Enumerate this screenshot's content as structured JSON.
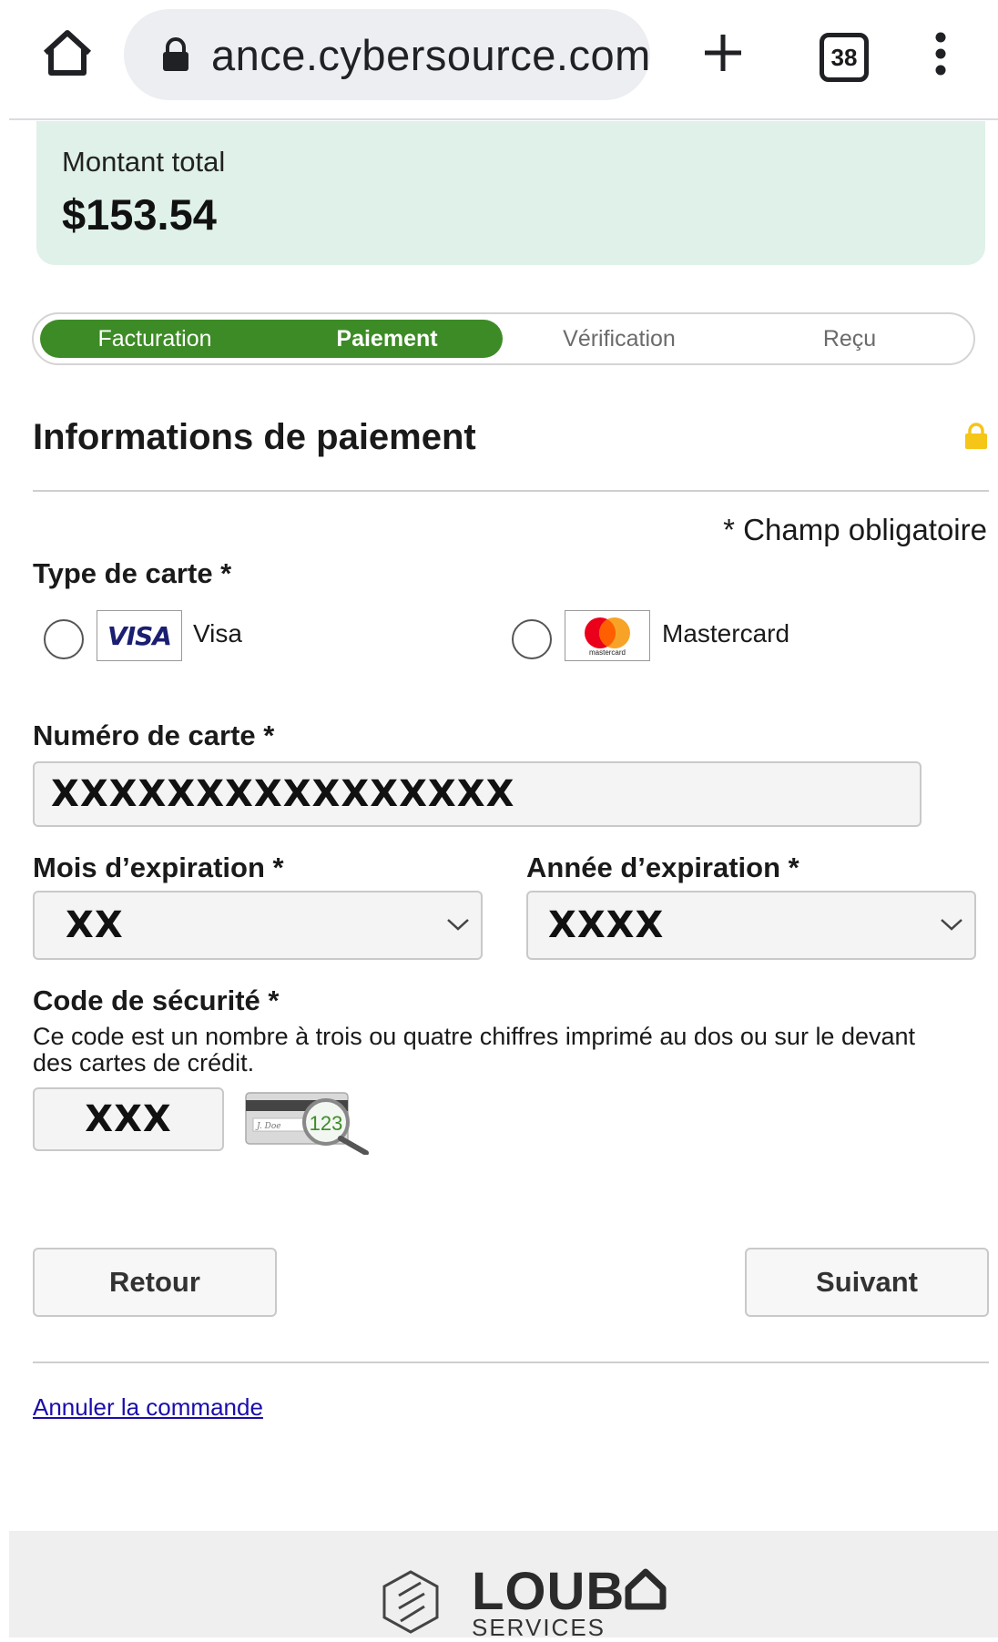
{
  "browser": {
    "url": "ance.cybersource.com",
    "tab_count": "38"
  },
  "summary": {
    "total_label": "Montant total",
    "total_amount": "$153.54"
  },
  "steps": [
    {
      "label": "Facturation",
      "state": "done"
    },
    {
      "label": "Paiement",
      "state": "current"
    },
    {
      "label": "Vérification",
      "state": "pending"
    },
    {
      "label": "Reçu",
      "state": "pending"
    }
  ],
  "form": {
    "title": "Informations de paiement",
    "required_note": "* Champ obligatoire",
    "card_type_label": "Type de carte *",
    "card_types": [
      {
        "name": "Visa",
        "logo_text": "VISA"
      },
      {
        "name": "Mastercard",
        "logo_text": "mastercard"
      }
    ],
    "card_number_label": "Numéro de carte *",
    "card_number_value": "XXXXXXXXXXXXXXXX",
    "exp_month_label": "Mois d’expiration *",
    "exp_month_value": "XX",
    "exp_year_label": "Année d’expiration *",
    "exp_year_value": "XXXX",
    "cvv_label": "Code de sécurité *",
    "cvv_help": "Ce code est un nombre à trois ou quatre chiffres imprimé au dos ou sur le devant des cartes de crédit.",
    "cvv_value": "XXX",
    "cvv_illustration_text": "123",
    "cvv_illustration_signature": "J. Doe"
  },
  "actions": {
    "back_label": "Retour",
    "next_label": "Suivant",
    "cancel_label": "Annuler la commande"
  },
  "footer": {
    "brand": "LOUB",
    "brand_sub": "SERVICES"
  },
  "colors": {
    "accent": "#3d8b26",
    "summary_bg": "#dff1e8",
    "link": "#1a0dab",
    "lock": "#f5c518"
  }
}
